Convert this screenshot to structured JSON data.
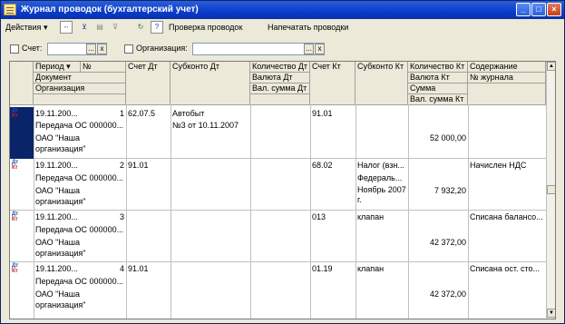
{
  "window": {
    "title": "Журнал проводок (бухгалтерский учет)"
  },
  "toolbar": {
    "actions_label": "Действия",
    "check_label": "Проверка проводок",
    "print_label": "Напечатать проводки"
  },
  "filter": {
    "account_label": "Счет:",
    "account_value": "",
    "org_label": "Организация:",
    "org_value": "",
    "select_btn": "...",
    "clear_btn": "x"
  },
  "columns": {
    "period": "Период",
    "number": "№",
    "document": "Документ",
    "organization": "Организация",
    "debit_account": "Счет Дт",
    "debit_subconto": "Субконто Дт",
    "debit_quantity": "Количество Дт",
    "debit_currency": "Валюта Дт",
    "debit_currency_sum": "Вал. сумма Дт",
    "credit_account": "Счет Кт",
    "credit_subconto": "Субконто Кт",
    "credit_quantity": "Количество Кт",
    "credit_currency": "Валюта Кт",
    "sum": "Сумма",
    "credit_currency_sum": "Вал. сумма Кт",
    "content": "Содержание",
    "journal_no": "№ журнала"
  },
  "rows": [
    {
      "period": "19.11.200...",
      "number": "1",
      "document": "Передача ОС 000000...",
      "org1": "ОАО \"Наша",
      "org2": "организация\"",
      "debit_account": "62.07.5",
      "debit_sub1": "Автобыт",
      "debit_sub2": "№3 от 10.11.2007",
      "credit_account": "91.01",
      "credit_sub1": "",
      "credit_sub2": "",
      "credit_sub3": "",
      "sum": "52 000,00",
      "content": "",
      "selected": true
    },
    {
      "period": "19.11.200...",
      "number": "2",
      "document": "Передача ОС 000000...",
      "org1": "ОАО \"Наша",
      "org2": "организация\"",
      "debit_account": "91.01",
      "debit_sub1": "",
      "debit_sub2": "",
      "credit_account": "68.02",
      "credit_sub1": "Налог (взн...",
      "credit_sub2": "Федераль...",
      "credit_sub3": "Ноябрь 2007 г.",
      "sum": "7 932,20",
      "content": "Начислен НДС",
      "selected": false
    },
    {
      "period": "19.11.200...",
      "number": "3",
      "document": "Передача ОС 000000...",
      "org1": "ОАО \"Наша",
      "org2": "организация\"",
      "debit_account": "",
      "debit_sub1": "",
      "debit_sub2": "",
      "credit_account": "013",
      "credit_sub1": "клапан",
      "credit_sub2": "",
      "credit_sub3": "",
      "sum": "42 372,00",
      "content": "Списана балансо...",
      "selected": false
    },
    {
      "period": "19.11.200...",
      "number": "4",
      "document": "Передача ОС 000000...",
      "org1": "ОАО \"Наша",
      "org2": "организация\"",
      "debit_account": "91.01",
      "debit_sub1": "",
      "debit_sub2": "",
      "credit_account": "01.19",
      "credit_sub1": "клапан",
      "credit_sub2": "",
      "credit_sub3": "",
      "sum": "42 372,00",
      "content": "Списана ост. сто...",
      "selected": false
    }
  ],
  "dk_icon": {
    "d": "Дт",
    "k": "Кт"
  },
  "colors": {
    "selection": "#0a246a",
    "header_bg": "#ece9d8",
    "title_bar": "#0a3ccc"
  }
}
